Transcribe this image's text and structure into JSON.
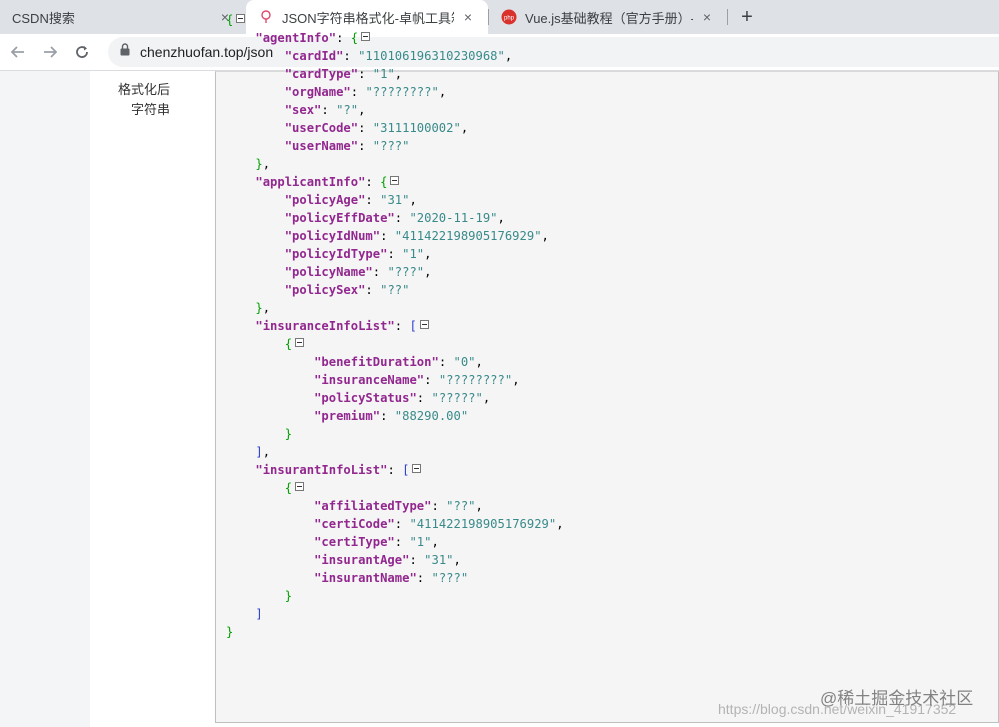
{
  "tabs": [
    {
      "title": "CSDN搜索",
      "close": "×"
    },
    {
      "title": "JSON字符串格式化-卓帆工具箱",
      "close": "×"
    },
    {
      "title": "Vue.js基础教程（官方手册）-在",
      "close": "×"
    }
  ],
  "new_tab": "+",
  "address": {
    "url": "chenzhuofan.top/json"
  },
  "sidebar_label": "格式化后字符串",
  "json_lines": [
    {
      "indent": 0,
      "parts": [
        [
          "bg",
          "{"
        ]
      ],
      "tog": true
    },
    {
      "indent": 1,
      "parts": [
        [
          "k",
          "\"agentInfo\""
        ],
        [
          "p",
          ": "
        ],
        [
          "bg",
          "{"
        ]
      ],
      "tog": true
    },
    {
      "indent": 2,
      "parts": [
        [
          "k",
          "\"cardId\""
        ],
        [
          "p",
          ": "
        ],
        [
          "s",
          "\"110106196310230968\""
        ],
        [
          "p",
          ","
        ]
      ]
    },
    {
      "indent": 2,
      "parts": [
        [
          "k",
          "\"cardType\""
        ],
        [
          "p",
          ": "
        ],
        [
          "s",
          "\"1\""
        ],
        [
          "p",
          ","
        ]
      ]
    },
    {
      "indent": 2,
      "parts": [
        [
          "k",
          "\"orgName\""
        ],
        [
          "p",
          ": "
        ],
        [
          "s",
          "\"????????\""
        ],
        [
          "p",
          ","
        ]
      ]
    },
    {
      "indent": 2,
      "parts": [
        [
          "k",
          "\"sex\""
        ],
        [
          "p",
          ": "
        ],
        [
          "s",
          "\"?\""
        ],
        [
          "p",
          ","
        ]
      ]
    },
    {
      "indent": 2,
      "parts": [
        [
          "k",
          "\"userCode\""
        ],
        [
          "p",
          ": "
        ],
        [
          "s",
          "\"3111100002\""
        ],
        [
          "p",
          ","
        ]
      ]
    },
    {
      "indent": 2,
      "parts": [
        [
          "k",
          "\"userName\""
        ],
        [
          "p",
          ": "
        ],
        [
          "s",
          "\"???\""
        ]
      ]
    },
    {
      "indent": 1,
      "parts": [
        [
          "bg",
          "}"
        ],
        [
          "p",
          ","
        ]
      ]
    },
    {
      "indent": 1,
      "parts": [
        [
          "k",
          "\"applicantInfo\""
        ],
        [
          "p",
          ": "
        ],
        [
          "bg",
          "{"
        ]
      ],
      "tog": true
    },
    {
      "indent": 2,
      "parts": [
        [
          "k",
          "\"policyAge\""
        ],
        [
          "p",
          ": "
        ],
        [
          "s",
          "\"31\""
        ],
        [
          "p",
          ","
        ]
      ]
    },
    {
      "indent": 2,
      "parts": [
        [
          "k",
          "\"policyEffDate\""
        ],
        [
          "p",
          ": "
        ],
        [
          "s",
          "\"2020-11-19\""
        ],
        [
          "p",
          ","
        ]
      ]
    },
    {
      "indent": 2,
      "parts": [
        [
          "k",
          "\"policyIdNum\""
        ],
        [
          "p",
          ": "
        ],
        [
          "s",
          "\"411422198905176929\""
        ],
        [
          "p",
          ","
        ]
      ]
    },
    {
      "indent": 2,
      "parts": [
        [
          "k",
          "\"policyIdType\""
        ],
        [
          "p",
          ": "
        ],
        [
          "s",
          "\"1\""
        ],
        [
          "p",
          ","
        ]
      ]
    },
    {
      "indent": 2,
      "parts": [
        [
          "k",
          "\"policyName\""
        ],
        [
          "p",
          ": "
        ],
        [
          "s",
          "\"???\""
        ],
        [
          "p",
          ","
        ]
      ]
    },
    {
      "indent": 2,
      "parts": [
        [
          "k",
          "\"policySex\""
        ],
        [
          "p",
          ": "
        ],
        [
          "s",
          "\"??\""
        ]
      ]
    },
    {
      "indent": 1,
      "parts": [
        [
          "bg",
          "}"
        ],
        [
          "p",
          ","
        ]
      ]
    },
    {
      "indent": 1,
      "parts": [
        [
          "k",
          "\"insuranceInfoList\""
        ],
        [
          "p",
          ": "
        ],
        [
          "bb",
          "["
        ]
      ],
      "tog": true
    },
    {
      "indent": 2,
      "parts": [
        [
          "bg",
          "{"
        ]
      ],
      "tog": true
    },
    {
      "indent": 3,
      "parts": [
        [
          "k",
          "\"benefitDuration\""
        ],
        [
          "p",
          ": "
        ],
        [
          "s",
          "\"0\""
        ],
        [
          "p",
          ","
        ]
      ]
    },
    {
      "indent": 3,
      "parts": [
        [
          "k",
          "\"insuranceName\""
        ],
        [
          "p",
          ": "
        ],
        [
          "s",
          "\"????????\""
        ],
        [
          "p",
          ","
        ]
      ]
    },
    {
      "indent": 3,
      "parts": [
        [
          "k",
          "\"policyStatus\""
        ],
        [
          "p",
          ": "
        ],
        [
          "s",
          "\"?????\""
        ],
        [
          "p",
          ","
        ]
      ]
    },
    {
      "indent": 3,
      "parts": [
        [
          "k",
          "\"premium\""
        ],
        [
          "p",
          ": "
        ],
        [
          "s",
          "\"88290.00\""
        ]
      ]
    },
    {
      "indent": 2,
      "parts": [
        [
          "bg",
          "}"
        ]
      ]
    },
    {
      "indent": 1,
      "parts": [
        [
          "bb",
          "]"
        ],
        [
          "p",
          ","
        ]
      ]
    },
    {
      "indent": 1,
      "parts": [
        [
          "k",
          "\"insurantInfoList\""
        ],
        [
          "p",
          ": "
        ],
        [
          "bb",
          "["
        ]
      ],
      "tog": true
    },
    {
      "indent": 2,
      "parts": [
        [
          "bg",
          "{"
        ]
      ],
      "tog": true
    },
    {
      "indent": 3,
      "parts": [
        [
          "k",
          "\"affiliatedType\""
        ],
        [
          "p",
          ": "
        ],
        [
          "s",
          "\"??\""
        ],
        [
          "p",
          ","
        ]
      ]
    },
    {
      "indent": 3,
      "parts": [
        [
          "k",
          "\"certiCode\""
        ],
        [
          "p",
          ": "
        ],
        [
          "s",
          "\"411422198905176929\""
        ],
        [
          "p",
          ","
        ]
      ]
    },
    {
      "indent": 3,
      "parts": [
        [
          "k",
          "\"certiType\""
        ],
        [
          "p",
          ": "
        ],
        [
          "s",
          "\"1\""
        ],
        [
          "p",
          ","
        ]
      ]
    },
    {
      "indent": 3,
      "parts": [
        [
          "k",
          "\"insurantAge\""
        ],
        [
          "p",
          ": "
        ],
        [
          "s",
          "\"31\""
        ],
        [
          "p",
          ","
        ]
      ]
    },
    {
      "indent": 3,
      "parts": [
        [
          "k",
          "\"insurantName\""
        ],
        [
          "p",
          ": "
        ],
        [
          "s",
          "\"???\""
        ]
      ]
    },
    {
      "indent": 2,
      "parts": [
        [
          "bg",
          "}"
        ]
      ]
    },
    {
      "indent": 1,
      "parts": [
        [
          "bb",
          "]"
        ]
      ]
    },
    {
      "indent": 0,
      "parts": [
        [
          "bg",
          "}"
        ]
      ]
    }
  ],
  "watermark": "@稀土掘金技术社区",
  "watermark_url": "https://blog.csdn.net/weixin_41917352"
}
